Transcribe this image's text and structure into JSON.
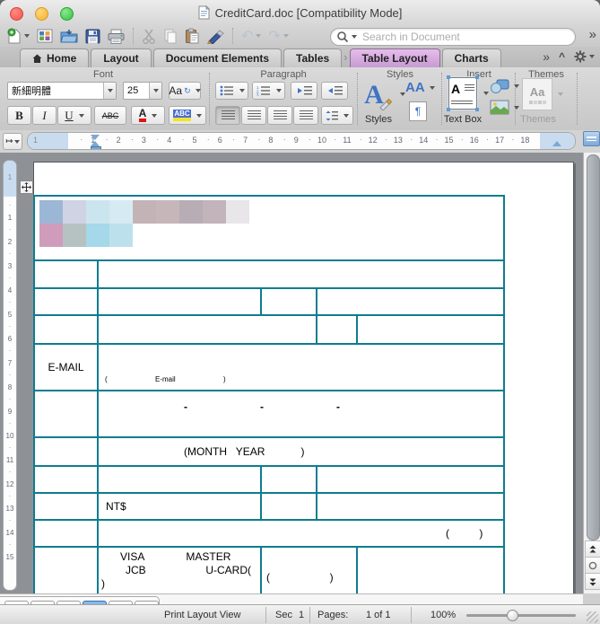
{
  "window": {
    "title": "CreditCard.doc [Compatibility Mode]"
  },
  "toolbar": {
    "search_placeholder": "Search in Document",
    "overflow": "»",
    "icons": [
      "new-document",
      "gallery",
      "open",
      "save",
      "print",
      "cut",
      "copy",
      "paste",
      "format-painter",
      "undo",
      "redo"
    ]
  },
  "tab_bar": {
    "tabs": [
      {
        "label": "Home",
        "active": false
      },
      {
        "label": "Layout",
        "active": false
      },
      {
        "label": "Document Elements",
        "active": false
      },
      {
        "label": "Tables",
        "active": false
      },
      {
        "label": "Table Layout",
        "active": true
      },
      {
        "label": "Charts",
        "active": false
      }
    ],
    "overflow": "»",
    "collapse": "^"
  },
  "ribbon": {
    "font": {
      "group_label": "Font",
      "font_name": "新細明體",
      "font_size": "25",
      "case_button": "Aa",
      "bold": "B",
      "italic": "I",
      "underline": "U",
      "strike": "ABC",
      "color_letter": "A",
      "highlight_letters": "ABC"
    },
    "paragraph": {
      "group_label": "Paragraph"
    },
    "styles": {
      "group_label": "Styles",
      "styles_label": "Styles",
      "big_letter": "A",
      "effects": "AA",
      "pilcrow": "¶"
    },
    "insert": {
      "group_label": "Insert",
      "textbox_label": "Text Box",
      "textbox_letter": "A"
    },
    "themes": {
      "group_label": "Themes",
      "themes_label": "Themes",
      "aa": "Aa"
    }
  },
  "ruler": {
    "h_numbers": [
      1,
      2,
      3,
      4,
      5,
      6,
      7,
      8,
      9,
      10,
      11,
      12,
      13,
      14,
      15,
      16,
      17,
      18
    ],
    "h_margin_number": "1",
    "v_numbers": [
      1,
      2,
      3,
      4,
      5,
      6,
      7,
      8,
      9,
      10,
      11,
      12,
      13,
      14,
      15
    ],
    "v_margin_number": "1"
  },
  "document": {
    "table": {
      "email_label": "E-MAIL",
      "email_hint": "(                        E-mail                        )",
      "dash": "-",
      "month_year": "(MONTH   YEAR            )",
      "nt": "NT$",
      "paren_small": "(          )",
      "visa_line1": "VISA              MASTER",
      "visa_line2": "JCB                    U-CARD(",
      "visa_line3": ")",
      "visa_paren": "(                    )"
    },
    "redacted_rows": [
      [
        "#9cb7d5",
        "#d0d3e3",
        "#cbe5ef",
        "#d6eaf2",
        "#c3b3b6",
        "#c6b6ba",
        "#b9adb5",
        "#c2b4ba",
        "#e8e6e9"
      ],
      [
        "#cf9dbb",
        "#b5c2c1",
        "#a5d8e8",
        "#bde1ec"
      ]
    ]
  },
  "status_bar": {
    "view_label": "Print Layout View",
    "sec_label": "Sec",
    "sec_value": "1",
    "pages_label": "Pages:",
    "pages_value": "1 of 1",
    "zoom_value": "100%"
  },
  "colors": {
    "table_border": "#0e7d8f",
    "active_tab": "#d8aee0",
    "indent_marker": "#7aa9d6"
  }
}
